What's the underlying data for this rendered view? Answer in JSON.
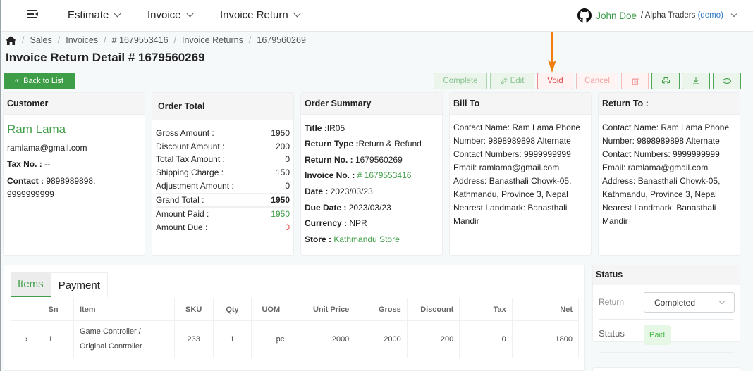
{
  "nav": {
    "menu_icon": "menu-collapse-icon",
    "items": [
      {
        "label": "Estimate"
      },
      {
        "label": "Invoice"
      },
      {
        "label": "Invoice Return"
      }
    ],
    "user": {
      "icon": "github-icon",
      "name": "John Doe",
      "separator": " / ",
      "org": "Alpha Traders",
      "demo": "(demo)"
    }
  },
  "breadcrumb": {
    "home_icon": "home-icon",
    "items": [
      "Sales",
      "Invoices",
      "# 1679553416",
      "Invoice Returns",
      "1679560269"
    ]
  },
  "page_title": "Invoice Return Detail # 1679560269",
  "toolbar": {
    "back_label": "Back to List",
    "complete_label": "Complete",
    "edit_label": "Edit",
    "void_label": "Void",
    "cancel_label": "Cancel",
    "delete_icon": "trash-icon",
    "print_icon": "printer-icon",
    "download_icon": "download-icon",
    "view_icon": "eye-icon"
  },
  "customer": {
    "heading": "Customer",
    "name": "Ram Lama",
    "email": "ramlama@gmail.com",
    "tax_label": "Tax No. :",
    "tax_value": " --",
    "contact_label": "Contact :",
    "contact_value": " 9898989898,",
    "contact_value2": "9999999999"
  },
  "order_total": {
    "heading": "Order Total",
    "rows": [
      {
        "label": "Gross Amount :",
        "value": "1950"
      },
      {
        "label": "Discount Amount :",
        "value": "200"
      },
      {
        "label": "Total Tax Amount :",
        "value": "0"
      },
      {
        "label": "Shipping Charge :",
        "value": "150"
      },
      {
        "label": "Adjustment Amount :",
        "value": "0"
      },
      {
        "label": "Grand Total :",
        "value": "1950"
      },
      {
        "label": "Amount Paid :",
        "value": "1950"
      },
      {
        "label": "Amount Due :",
        "value": "0"
      }
    ]
  },
  "order_summary": {
    "heading": "Order Summary",
    "title_label": "Title :",
    "title_value": "IR05",
    "return_type_label": "Return Type :",
    "return_type_value": "Return & Refund",
    "return_no_label": "Return No. :",
    "return_no_value": " 1679560269",
    "invoice_no_label": "Invoice No. :",
    "invoice_no_value": " # 1679553416",
    "date_label": "Date :",
    "date_value": " 2023/03/23",
    "due_date_label": "Due Date :",
    "due_date_value": " 2023/03/23",
    "currency_label": "Currency :",
    "currency_value": " NPR",
    "store_label": "Store :",
    "store_value": " Kathmandu Store"
  },
  "bill_to": {
    "heading": "Bill To",
    "text": "Contact Name: Ram Lama Phone Number: 9898989898 Alternate Contact Numbers: 9999999999 Email: ramlama@gmail.com Address: Banasthali Chowk-05, Kathmandu, Province 3, Nepal Nearest Landmark: Banasthali Mandir"
  },
  "return_to": {
    "heading": "Return To :",
    "text": "Contact Name: Ram Lama Phone Number: 9898989898 Alternate Contact Numbers: 9999999999 Email: ramlama@gmail.com Address: Banasthali Chowk-05, Kathmandu, Province 3, Nepal Nearest Landmark: Banasthali Mandir"
  },
  "items_panel": {
    "tabs": [
      {
        "label": "Items",
        "active": true
      },
      {
        "label": "Payment",
        "active": false
      }
    ],
    "columns": [
      "",
      "Sn",
      "Item",
      "SKU",
      "Qty",
      "UOM",
      "Unit Price",
      "Gross",
      "Discount",
      "Tax",
      "Net"
    ],
    "rows": [
      {
        "expand": "›",
        "sn": "1",
        "item": "Game Controller / Original Controller",
        "sku": "233",
        "qty": "1",
        "uom": "pc",
        "unit_price": "2000",
        "gross": "2000",
        "discount": "200",
        "tax": "0",
        "net": "1800"
      }
    ]
  },
  "status_panel": {
    "heading": "Status",
    "return_label": "Return",
    "return_value": "Completed",
    "status_label": "Status",
    "status_value": "Paid"
  },
  "colors": {
    "brand_green": "#3e9d47",
    "danger_red": "#e04848",
    "link_blue": "#2a78c6",
    "annotation_orange": "#f07d0e"
  }
}
